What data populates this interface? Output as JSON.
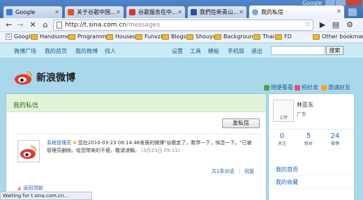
{
  "browser": {
    "brand": "Google",
    "tabs": [
      {
        "label": "Google"
      },
      {
        "label": "关于谷歌中国..."
      },
      {
        "label": "谷歌服务在中..."
      },
      {
        "label": "我們在新青山..."
      },
      {
        "label": "我的私信"
      }
    ],
    "url_host": "http://t.sina.com.cn",
    "url_path": "/messages",
    "bookmarks": [
      "Google",
      "Handsome",
      "Programms",
      "Houses",
      "Funvzi",
      "Blogs",
      "Shouyu",
      "Background",
      "Thai",
      "FD"
    ],
    "other_bookmarks": "Other bookmarks",
    "status": "Waiting for t.sina.com.cn..."
  },
  "nav": {
    "items": [
      "微博广场",
      "我的首页",
      "我的微博",
      "找人"
    ],
    "right_items": [
      "设置",
      "工具",
      "模板",
      "手机版",
      "退出"
    ],
    "search_button": "搜索"
  },
  "logo": {
    "text": "新浪微博"
  },
  "quicklinks": [
    "随便看看",
    "拍抄发",
    "邀请好友"
  ],
  "main": {
    "title": "我的私信",
    "send_button": "发私信",
    "message": {
      "sender": "系统管理员",
      "badge": "V",
      "text": "您在2010-03-23 08:14:48发表的微博\"谷歌走了，数学一下，悼念一下。\"已被管理员删除。给您带来的不便，敬请谅解。",
      "time": "(3月23日 09:11)",
      "count_label": "共1条对话",
      "reply_label": "回复"
    },
    "back_top": "返回顶部"
  },
  "profile": {
    "upload_label": "上传",
    "name": "林亚东",
    "location": "广东",
    "stats": [
      {
        "num": "0",
        "label": "关注"
      },
      {
        "num": "5",
        "label": "粉丝"
      },
      {
        "num": "24",
        "label": "微博"
      }
    ],
    "nav": [
      "我的首页",
      "我的收藏"
    ]
  },
  "colors": {
    "accent": "#1b64b4",
    "header_green": "#e3f3d9",
    "sky": "#a9d7ec"
  }
}
